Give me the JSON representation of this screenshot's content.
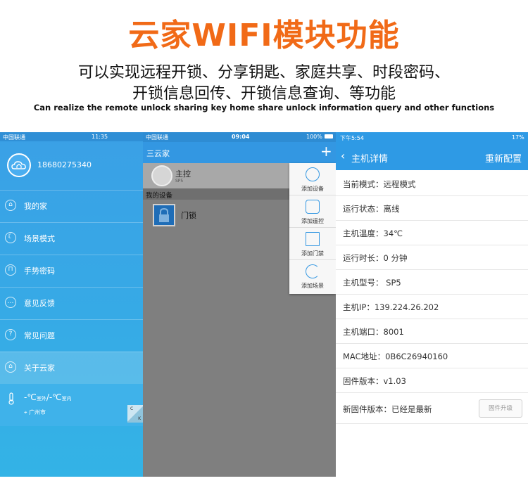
{
  "header": {
    "title": "云家WIFI模块功能",
    "subtitle_line1": "可以实现远程开锁、分享钥匙、家庭共享、时段密码、",
    "subtitle_line2": "开锁信息回传、开锁信息查询、等功能",
    "english": "Can realize the remote unlock sharing key home share unlock information query and other functions"
  },
  "phone1": {
    "status": {
      "carrier": "中国联通",
      "time": "11:35"
    },
    "phone_number": "18680275340",
    "menu": [
      {
        "label": "我的家",
        "icon": "home-icon"
      },
      {
        "label": "场景模式",
        "icon": "moon-icon"
      },
      {
        "label": "手势密码",
        "icon": "lock-icon"
      },
      {
        "label": "意见反馈",
        "icon": "chat-icon"
      },
      {
        "label": "常见问题",
        "icon": "question-icon"
      },
      {
        "label": "关于云家",
        "icon": "home-icon"
      }
    ],
    "weather": {
      "temp": "-℃",
      "outdoor": "室外",
      "sep": "/-℃",
      "indoor": "室内",
      "city": "广州市"
    },
    "corner": {
      "top": "C",
      "bottom": "K"
    }
  },
  "phone2": {
    "status": {
      "carrier": "中国联通",
      "time": "09:04",
      "battery": "100%"
    },
    "app_title": "三云家",
    "add": "+",
    "main_device": {
      "name": "主控",
      "model": "SP5"
    },
    "section": "我的设备",
    "lock_name": "门锁",
    "popup": [
      {
        "label": "添加设备",
        "icon": "power-icon"
      },
      {
        "label": "添加遥控",
        "icon": "remote-icon"
      },
      {
        "label": "添加门禁",
        "icon": "door-icon"
      },
      {
        "label": "添加场景",
        "icon": "moon-icon"
      }
    ]
  },
  "phone3": {
    "status": {
      "time": "下午5:54",
      "battery": "17%"
    },
    "app_title": "主机详情",
    "reconfig": "重新配置",
    "rows": [
      "当前模式：远程模式",
      "运行状态：离线",
      "主机温度：34℃",
      "运行时长：0 分钟",
      "主机型号： SP5",
      "主机IP：139.224.26.202",
      "主机端口：8001",
      "MAC地址：0B6C26940160",
      "固件版本：v1.03",
      "新固件版本：已经是最新"
    ],
    "upgrade": "固件升级"
  },
  "colors": {
    "accent": "#f16a17",
    "app_blue": "#3397e2"
  }
}
